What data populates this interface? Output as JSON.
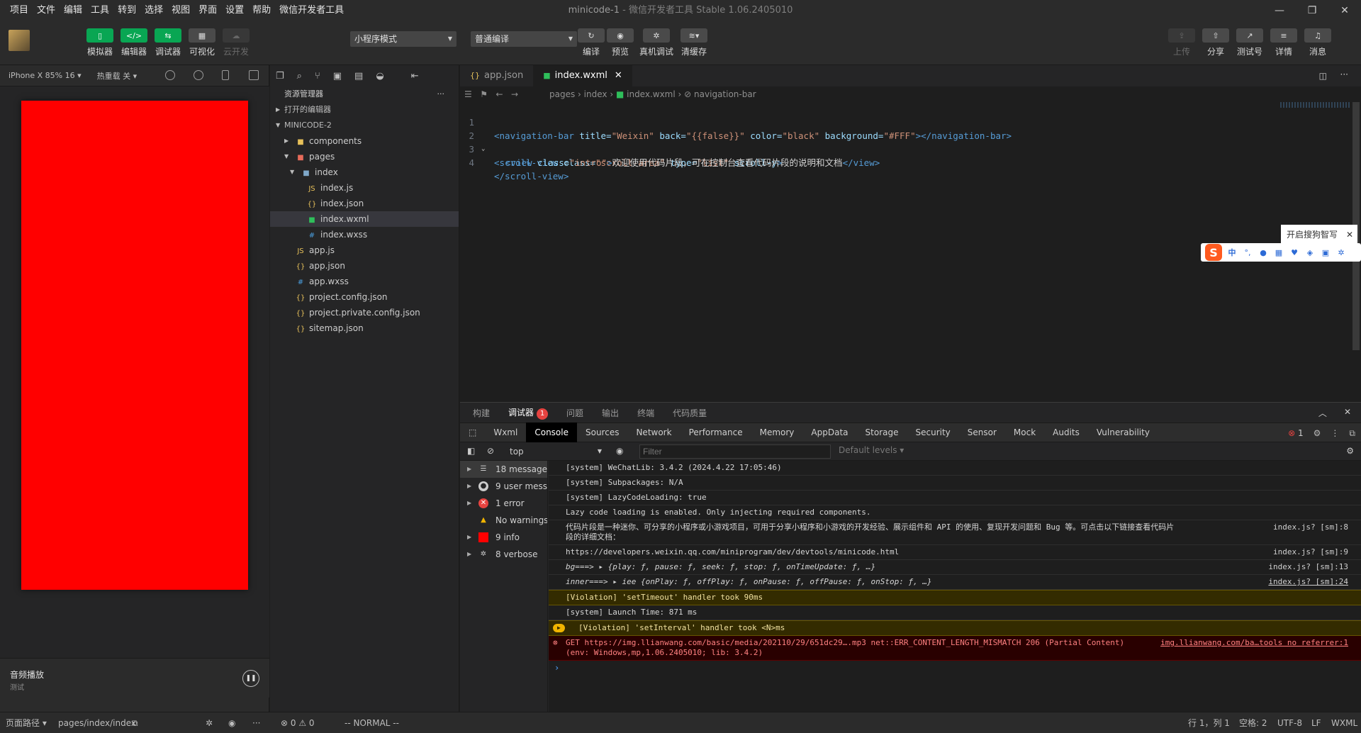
{
  "menu": [
    "项目",
    "文件",
    "编辑",
    "工具",
    "转到",
    "选择",
    "视图",
    "界面",
    "设置",
    "帮助",
    "微信开发者工具"
  ],
  "window": {
    "title": "minicode-1",
    "app": " - 微信开发者工具 Stable 1.06.2405010",
    "minimize": "—",
    "maximize": "❐",
    "close": "✕"
  },
  "toolbar": {
    "simulator": "模拟器",
    "editor": "编辑器",
    "debugger": "调试器",
    "visual": "可视化",
    "cloud": "云开发",
    "mode": "小程序模式",
    "compile_mode": "普通编译",
    "compile": "编译",
    "preview": "预览",
    "remote_debug": "真机调试",
    "clear_cache": "清缓存",
    "upload": "上传",
    "share": "分享",
    "test": "测试号",
    "details": "详情",
    "messages": "消息"
  },
  "simulator": {
    "device": "iPhone X 85% 16 ▾",
    "hot_reload": "热重载 关 ▾",
    "audio_title": "音频播放",
    "audio_sub": "测试",
    "phone_color": "#ff0000"
  },
  "explorer": {
    "title": "资源管理器",
    "more": "···",
    "open_editors": "打开的编辑器",
    "project": "MINICODE-2",
    "files": [
      {
        "name": "components",
        "type": "folder"
      },
      {
        "name": "pages",
        "type": "folder"
      },
      {
        "name": "index",
        "type": "folder"
      },
      {
        "name": "index.js",
        "type": "js"
      },
      {
        "name": "index.json",
        "type": "json"
      },
      {
        "name": "index.wxml",
        "type": "wxml"
      },
      {
        "name": "index.wxss",
        "type": "wxss"
      },
      {
        "name": "app.js",
        "type": "js"
      },
      {
        "name": "app.json",
        "type": "json"
      },
      {
        "name": "app.wxss",
        "type": "wxss"
      },
      {
        "name": "project.config.json",
        "type": "json"
      },
      {
        "name": "project.private.config.json",
        "type": "json"
      },
      {
        "name": "sitemap.json",
        "type": "json"
      }
    ]
  },
  "editor": {
    "tabs": [
      "app.json",
      "index.wxml"
    ],
    "breadcrumb": [
      "pages",
      "index",
      "index.wxml",
      "navigation-bar"
    ],
    "lines": [
      "1",
      "2",
      "3",
      "4"
    ],
    "code": {
      "l1": {
        "open": "<navigation-bar",
        "a1": " title=",
        "v1": "\"Weixin\"",
        "a2": " back=",
        "v2": "\"{{false}}\"",
        "a3": " color=",
        "v3": "\"black\"",
        "a4": " background=",
        "v4": "\"#FFF\"",
        "close": "></navigation-bar>"
      },
      "l2": {
        "open": "<scroll-view",
        "a1": " class=",
        "v1": "\"scroll-area\"",
        "a2": " type=",
        "v2": "\"list\"",
        "a3": " scroll-y",
        "close": ">"
      },
      "l3": {
        "open": "<view",
        "a1": " class=",
        "v1": "\"intro\"",
        "gt": ">",
        "text": "欢迎使用代码片段，可在控制台查看代码片段的说明和文档",
        "close": "</view>"
      },
      "l4": {
        "close": "</scroll-view>"
      }
    }
  },
  "ime": {
    "tip": "开启搜狗智写",
    "close": "✕",
    "logo": "S",
    "lang": "中"
  },
  "panel": {
    "tabs": [
      "构建",
      "调试器",
      "问题",
      "输出",
      "终端",
      "代码质量"
    ],
    "badge": "1",
    "devtools_tabs": [
      "Wxml",
      "Console",
      "Sources",
      "Network",
      "Performance",
      "Memory",
      "AppData",
      "Storage",
      "Security",
      "Sensor",
      "Mock",
      "Audits",
      "Vulnerability"
    ],
    "error_count": "1",
    "context": "top",
    "filter_placeholder": "Filter",
    "levels": "Default levels ▾",
    "sidebar": [
      {
        "label": "18 messages",
        "icon": "list"
      },
      {
        "label": "9 user mess...",
        "icon": "user"
      },
      {
        "label": "1 error",
        "icon": "error"
      },
      {
        "label": "No warnings",
        "icon": "warning"
      },
      {
        "label": "9 info",
        "icon": "info"
      },
      {
        "label": "8 verbose",
        "icon": "verbose"
      }
    ],
    "messages": [
      {
        "text": "[system] WeChatLib: 3.4.2 (2024.4.22 17:05:46)",
        "src": ""
      },
      {
        "text": "[system] Subpackages: N/A",
        "src": ""
      },
      {
        "text": "[system] LazyCodeLoading: true",
        "src": ""
      },
      {
        "text": "Lazy code loading is enabled. Only injecting required components.",
        "src": ""
      },
      {
        "text": "代码片段是一种迷你、可分享的小程序或小游戏项目，可用于分享小程序和小游戏的开发经验、展示组件和 API 的使用、复现开发问题和 Bug 等。可点击以下链接查看代码片段的详细文档：",
        "src": "index.js? [sm]:8"
      },
      {
        "text": "https://developers.weixin.qq.com/miniprogram/dev/devtools/minicode.html",
        "src": "index.js? [sm]:9"
      },
      {
        "text": "bg===> ▸ {play: ƒ, pause: ƒ, seek: ƒ, stop: ƒ, onTimeUpdate: ƒ, …}",
        "src": "index.js? [sm]:13"
      },
      {
        "text": "inner===> ▸ iee {onPlay: ƒ, offPlay: ƒ, onPause: ƒ, offPause: ƒ, onStop: ƒ, …}",
        "src": "index.js? [sm]:24"
      },
      {
        "text": "[Violation] 'setTimeout' handler took 90ms",
        "src": ""
      },
      {
        "text": "[system] Launch Time: 871 ms",
        "src": ""
      },
      {
        "text": "[Violation] 'setInterval' handler took <N>ms",
        "src": ""
      },
      {
        "text": "GET https://img.llianwang.com/basic/media/202110/29/651dc29….mp3 net::ERR_CONTENT_LENGTH_MISMATCH 206 (Partial Content)",
        "text2": "(env: Windows,mp,1.06.2405010; lib: 3.4.2)",
        "src": "img.llianwang.com/ba…tools no referrer:1"
      }
    ],
    "prompt": "›"
  },
  "statusbar": {
    "path_label": "页面路径 ▾",
    "path": "pages/index/index",
    "problems": "⊗ 0 ⚠ 0",
    "mode": "-- NORMAL --",
    "position": "行 1，列 1",
    "spaces": "空格: 2",
    "encoding": "UTF-8",
    "eol": "LF",
    "language": "WXML"
  }
}
